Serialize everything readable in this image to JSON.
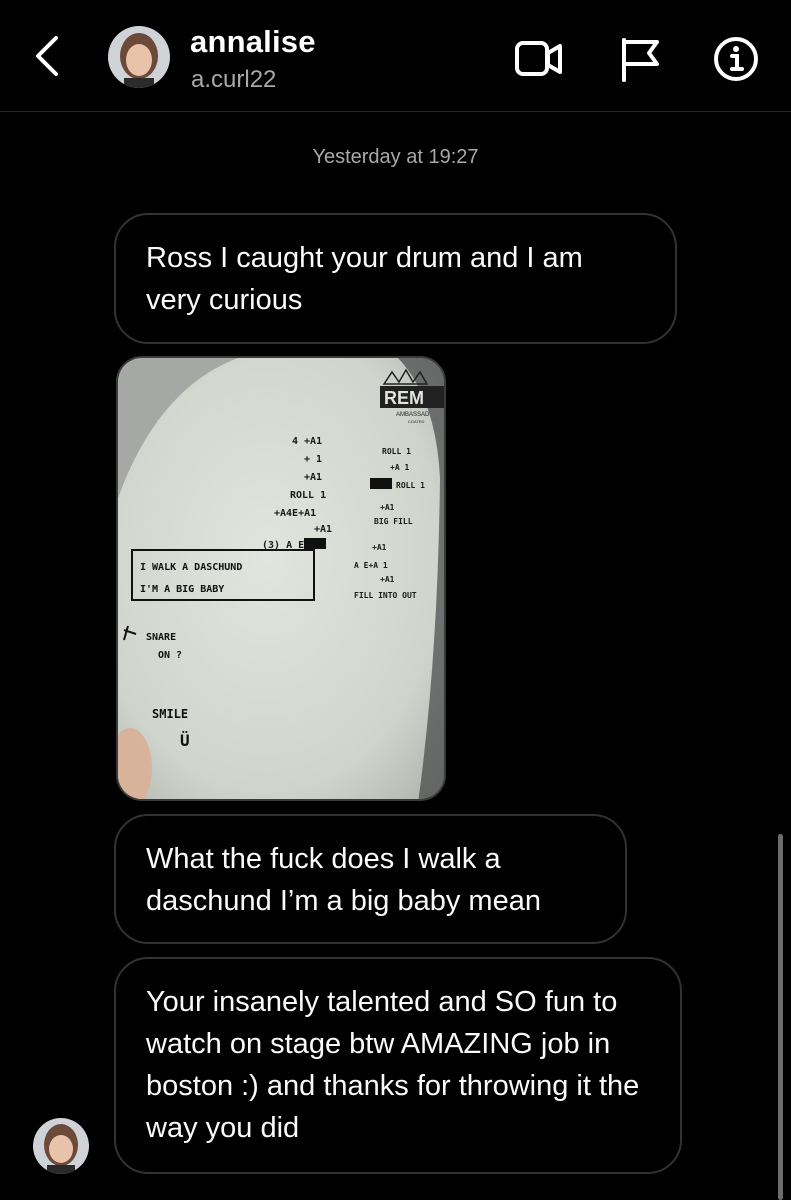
{
  "header": {
    "back_icon": "chevron-left-icon",
    "name": "annalise",
    "username": "a.curl22",
    "actions": [
      "video-call-icon",
      "flag-icon",
      "info-icon"
    ]
  },
  "thread": {
    "timestamp": "Yesterday at 19:27",
    "messages": [
      {
        "type": "text",
        "text": "Ross I caught your drum and I am very curious"
      },
      {
        "type": "image",
        "description_icon": "photo"
      },
      {
        "type": "text",
        "text": "What the fuck does I walk a daschund I’m a big baby mean"
      },
      {
        "type": "text",
        "text": "Your insanely talented and SO fun to watch on stage btw AMAZING job in boston :) and thanks for throwing it the way you did"
      }
    ]
  },
  "drum_photo": {
    "logo_text": "REM",
    "logo_sub": "AMBASSAD",
    "logo_sub2": "COATED",
    "notes_left": [
      "4 +A1",
      "+ 1",
      "+A1",
      "ROLL 1",
      "+A4E+A1",
      "+A1",
      "(3) A    E A1"
    ],
    "notes_right": [
      "ROLL 1",
      "+A 1",
      "ROLL 1",
      "+A1",
      "BIG FILL",
      "+A1",
      "A E+A 1",
      "+A1",
      "FILL INTO OUT"
    ],
    "boxed_line1": "I WALK  A  DASCHUND",
    "boxed_line2": "I'M  A   BIG  BABY",
    "snare_line1": "SNARE",
    "snare_line2": "ON ?",
    "smile": "SMILE",
    "smile_face": "Ü"
  },
  "colors": {
    "background": "#000000",
    "bubble_border": "#323232",
    "secondary_text": "#a8a8a8"
  }
}
